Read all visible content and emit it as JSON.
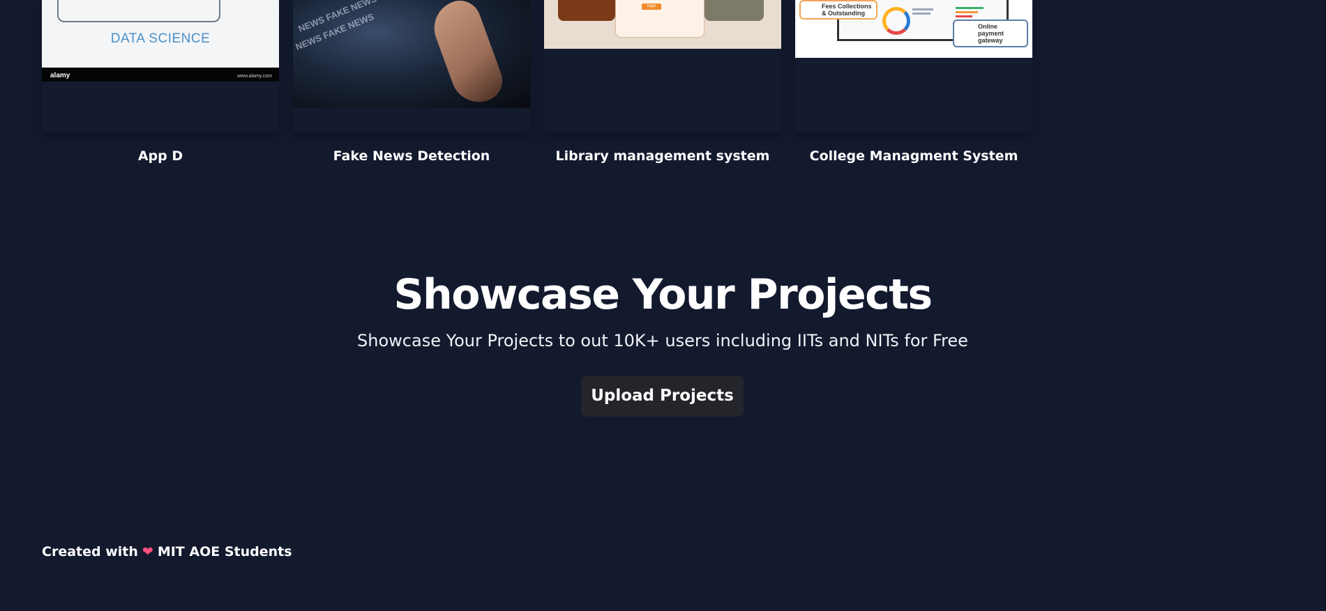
{
  "projects": [
    {
      "title": "App D",
      "image": {
        "caption": "DATA SCIENCE",
        "watermark": "alamy",
        "url_text": "www.alamy.com"
      }
    },
    {
      "title": "Fake News Detection",
      "image": {
        "overlay_text": "NEWS FAKE NEWS"
      }
    },
    {
      "title": "Library management system",
      "image": {
        "button_text": "login"
      }
    },
    {
      "title": "College Managment System",
      "image": {
        "badge_fees": "Fees Collections & Outstanding",
        "badge_payment": "Online payment gateway"
      }
    }
  ],
  "hero": {
    "title": "Showcase Your Projects",
    "subtitle": "Showcase Your Projects to out 10K+ users including IITs and NITs for Free",
    "button_label": "Upload Projects"
  },
  "footer": {
    "prefix": "Created with",
    "icon": "heart-icon",
    "suffix": "MIT AOE Students"
  },
  "colors": {
    "background": "#131a2e",
    "button": "#23252a",
    "text": "#ffffff"
  }
}
